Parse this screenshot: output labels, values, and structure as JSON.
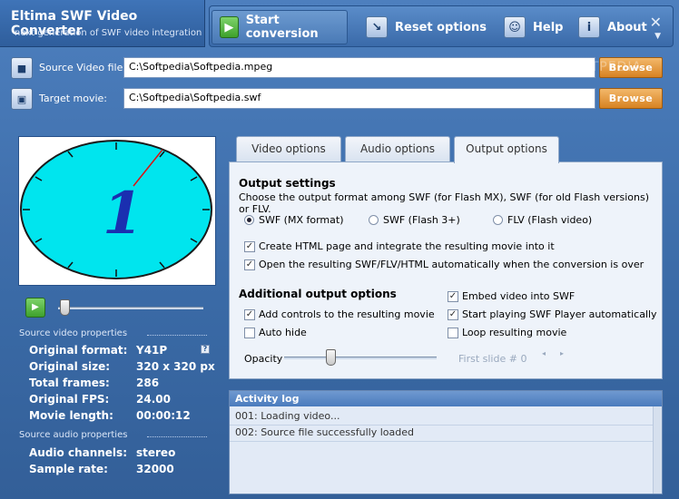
{
  "app": {
    "title": "Eltima SWF Video Converter",
    "subtitle": "next generation of SWF video integration"
  },
  "toolbar": {
    "start_label": "Start conversion",
    "reset_label": "Reset options",
    "help_label": "Help",
    "about_label": "About",
    "close_glyph": "✕",
    "down_glyph": "▼"
  },
  "files": {
    "source_label": "Source Video file:",
    "source_value": "C:\\Softpedia\\Softpedia.mpeg",
    "target_label": "Target movie:",
    "target_value": "C:\\Softpedia\\Softpedia.swf",
    "browse_label": "Browse"
  },
  "watermark": "SOFTPEDIA",
  "preview": {
    "clock_digit": "1",
    "seek_position": 0.0
  },
  "video_props": {
    "title": "Source video properties",
    "rows": [
      {
        "label": "Original format:",
        "value": "Y41P"
      },
      {
        "label": "Original size:",
        "value": "320 x 320 px"
      },
      {
        "label": "Total frames:",
        "value": "286"
      },
      {
        "label": "Original FPS:",
        "value": "24.00"
      },
      {
        "label": "Movie length:",
        "value": "00:00:12"
      }
    ],
    "help_mark": "?"
  },
  "audio_props": {
    "title": "Source audio properties",
    "rows": [
      {
        "label": "Audio channels:",
        "value": "stereo"
      },
      {
        "label": "Sample rate:",
        "value": "32000"
      }
    ]
  },
  "tabs": [
    {
      "label": "Video options",
      "active": false
    },
    {
      "label": "Audio options",
      "active": false
    },
    {
      "label": "Output options",
      "active": true
    }
  ],
  "output": {
    "settings_title": "Output settings",
    "settings_desc": "Choose the output format among SWF (for Flash MX), SWF (for old Flash versions) or FLV.",
    "radios": [
      {
        "label": "SWF (MX format)",
        "checked": true
      },
      {
        "label": "SWF (Flash 3+)",
        "checked": false
      },
      {
        "label": "FLV (Flash video)",
        "checked": false
      }
    ],
    "chk_html": "Create HTML page and integrate the resulting movie into it",
    "chk_open": "Open the resulting SWF/FLV/HTML automatically when the conversion is over",
    "additional_title": "Additional output options",
    "chk_controls": "Add controls to the resulting movie",
    "chk_autohide": "Auto hide",
    "chk_embed": "Embed video into SWF",
    "chk_autoplay": "Start playing SWF Player automatically",
    "chk_loop": "Loop resulting movie",
    "opacity_label": "Opacity",
    "opacity_level": 0.3,
    "first_slide": "First slide # 0"
  },
  "log": {
    "title": "Activity log",
    "lines": [
      "001: Loading video...",
      "002: Source file successfully loaded"
    ]
  },
  "colors": {
    "accent": "#3a6aa6",
    "browse": "#d78222",
    "preview_fill": "#00e5ee"
  }
}
